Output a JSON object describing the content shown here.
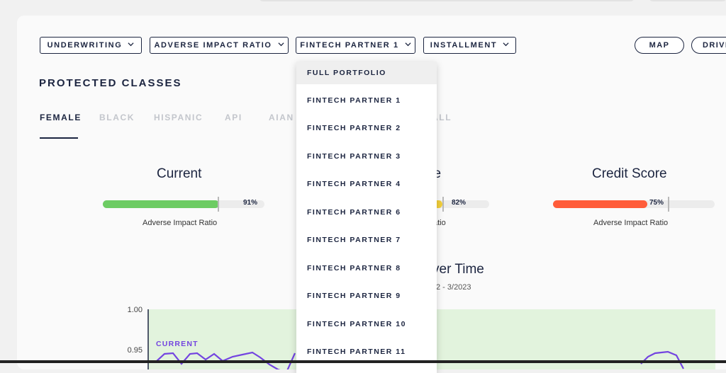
{
  "filters": [
    {
      "label": "UNDERWRITING"
    },
    {
      "label": "ADVERSE IMPACT RATIO"
    },
    {
      "label": "FINTECH PARTNER 1"
    },
    {
      "label": "INSTALLMENT"
    }
  ],
  "view_buttons": {
    "map": "MAP",
    "drivers": "DRIVE"
  },
  "section_title": "PROTECTED CLASSES",
  "tabs": [
    {
      "label": "FEMALE",
      "active": true
    },
    {
      "label": "BLACK"
    },
    {
      "label": "HISPANIC"
    },
    {
      "label": "API"
    },
    {
      "label": "AIAN"
    },
    {
      "label": "ALL"
    }
  ],
  "metrics": [
    {
      "title": "Current",
      "percent": "91%",
      "value": 0.91,
      "color": "#6dcc63",
      "sublabel": "Adverse Impact Ratio"
    },
    {
      "title": "ve",
      "percent": "82%",
      "value": 0.82,
      "color": "#f2cf3a",
      "sublabel": "atio"
    },
    {
      "title": "Credit Score",
      "percent": "75%",
      "value": 0.75,
      "color": "#ff5c3a",
      "sublabel": "Adverse Impact Ratio"
    }
  ],
  "chart": {
    "title": "ver Time",
    "subtitle": "2 - 3/2023",
    "y_ticks": [
      "1.00",
      "0.95"
    ],
    "series_label": "CURRENT",
    "colors": {
      "line": "#7344e0",
      "band": "#e2f3dd"
    }
  },
  "chart_data": {
    "type": "line",
    "title": "ver Time",
    "ylim": [
      0.93,
      1.0
    ],
    "series": [
      {
        "name": "CURRENT",
        "values": [
          0.945,
          0.95,
          0.94,
          0.948,
          0.94,
          0.951,
          0.946,
          0.95,
          0.942,
          0.948,
          0.944,
          0.95,
          0.946,
          0.952,
          0.945,
          0.94
        ]
      }
    ]
  },
  "dropdown": {
    "items": [
      {
        "label": "FULL PORTFOLIO",
        "highlighted": true
      },
      {
        "label": "FINTECH PARTNER 1"
      },
      {
        "label": "FINTECH PARTNER 2"
      },
      {
        "label": "FINTECH PARTNER 3"
      },
      {
        "label": "FINTECH PARTNER 4"
      },
      {
        "label": "FINTECH PARTNER 6"
      },
      {
        "label": "FINTECH PARTNER 7"
      },
      {
        "label": "FINTECH PARTNER 8"
      },
      {
        "label": "FINTECH PARTNER 9"
      },
      {
        "label": "FINTECH PARTNER 10"
      },
      {
        "label": "FINTECH PARTNER 11"
      }
    ]
  },
  "icons": {
    "chevron": "chevron-down-icon"
  }
}
